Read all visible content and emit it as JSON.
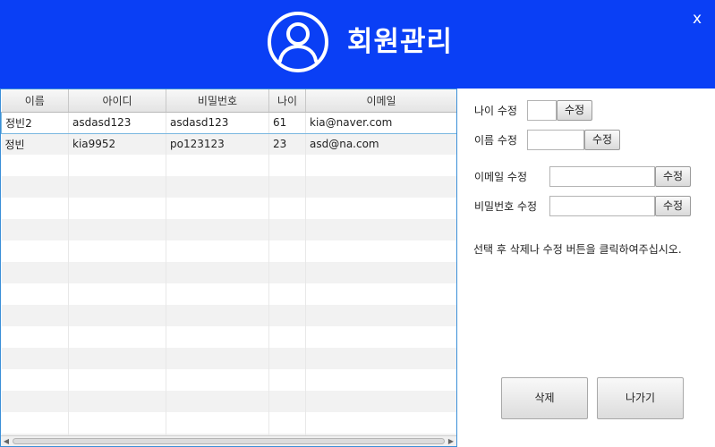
{
  "header": {
    "title": "회원관리",
    "close_label": "x",
    "icon": "user-icon",
    "bg_color": "#0a3ff5"
  },
  "table": {
    "columns": [
      "이름",
      "아이디",
      "비밀번호",
      "나이",
      "이메일"
    ],
    "rows": [
      [
        "정빈2",
        "asdasd123",
        "asdasd123",
        "61",
        "kia@naver.com"
      ],
      [
        "정빈",
        "kia9952",
        "po123123",
        "23",
        "asd@na.com"
      ]
    ],
    "selected_row": 0
  },
  "form": {
    "age_label": "나이 수정",
    "age_value": "",
    "age_button": "수정",
    "name_label": "이름 수정",
    "name_value": "",
    "name_button": "수정",
    "email_label": "이메일 수정",
    "email_value": "",
    "email_button": "수정",
    "password_label": "비밀번호 수정",
    "password_value": "",
    "password_button": "수정",
    "hint": "선택 후 삭제나 수정 버튼을 클릭하여주십시오."
  },
  "actions": {
    "delete_label": "삭제",
    "exit_label": "나가기"
  }
}
